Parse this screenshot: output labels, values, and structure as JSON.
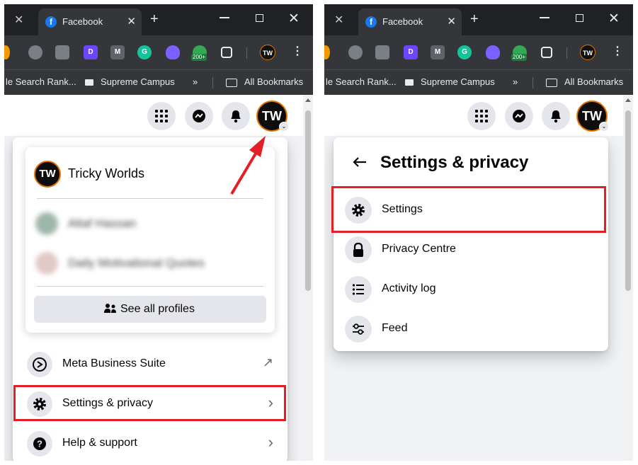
{
  "browser": {
    "tab_title": "Facebook",
    "tab_favicon": "f",
    "extensions": [
      "D",
      "M",
      "G"
    ],
    "extension_badge": "200+",
    "profile_initials": "TW",
    "bookmarks": [
      "le Search Rank...",
      "Supreme Campus",
      "All Bookmarks"
    ],
    "overflow": "»"
  },
  "facebook": {
    "avatar_initials": "TW",
    "avatar_chevron": "⌄"
  },
  "account_menu": {
    "profile_name": "Tricky Worlds",
    "blurred_profiles": [
      "Altaf Hassan",
      "Daily Motivational Quotes"
    ],
    "see_all_label": "See all profiles",
    "items": [
      {
        "label": "Meta Business Suite",
        "icon": "meta-business-suite-icon",
        "trail": "↗"
      },
      {
        "label": "Settings & privacy",
        "icon": "gear-icon",
        "trail": "›"
      },
      {
        "label": "Help & support",
        "icon": "help-icon",
        "trail": "›"
      }
    ]
  },
  "settings_privacy": {
    "title": "Settings & privacy",
    "items": [
      {
        "label": "Settings",
        "icon": "gear-icon"
      },
      {
        "label": "Privacy Centre",
        "icon": "lock-icon"
      },
      {
        "label": "Activity log",
        "icon": "list-icon"
      },
      {
        "label": "Feed",
        "icon": "sliders-icon"
      }
    ]
  },
  "colors": {
    "highlight": "#e41e26",
    "facebook_blue": "#1877f2",
    "chrome_dark": "#202124"
  }
}
